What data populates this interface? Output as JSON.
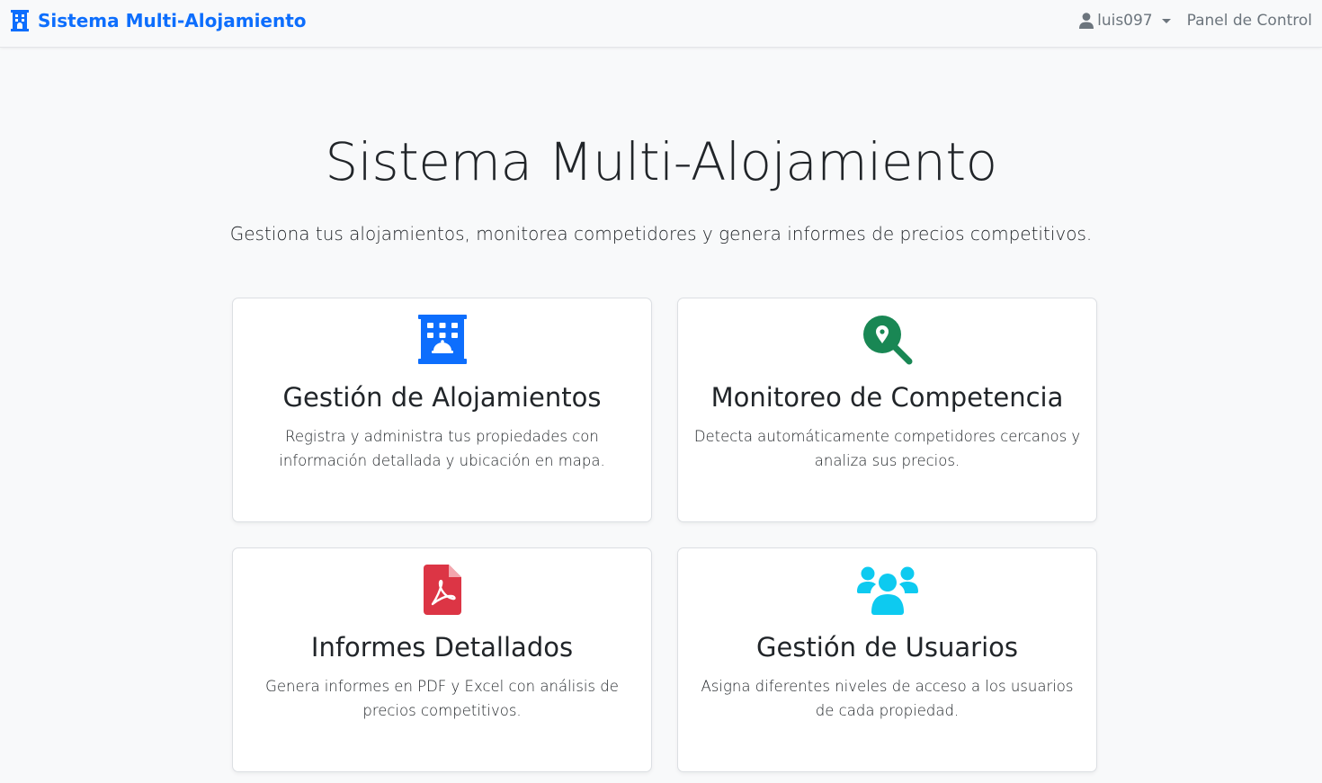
{
  "navbar": {
    "brand": "Sistema Multi-Alojamiento",
    "brand_icon": "building-icon",
    "username": "luis097",
    "user_icon": "user-icon",
    "panel_link": "Panel de Control"
  },
  "hero": {
    "title": "Sistema Multi-Alojamiento",
    "subtitle": "Gestiona tus alojamientos, monitorea competidores y genera informes de precios competitivos."
  },
  "features": [
    {
      "icon": "hotel-icon",
      "color": "#0d6efd",
      "title": "Gestión de Alojamientos",
      "text": "Registra y administra tus propiedades con información detallada y ubicación en mapa."
    },
    {
      "icon": "search-location-icon",
      "color": "#198754",
      "title": "Monitoreo de Competencia",
      "text": "Detecta automáticamente competidores cercanos y analiza sus precios."
    },
    {
      "icon": "file-pdf-icon",
      "color": "#dc3545",
      "title": "Informes Detallados",
      "text": "Genera informes en PDF y Excel con análisis de precios competitivos."
    },
    {
      "icon": "users-icon",
      "color": "#0dcaf0",
      "title": "Gestión de Usuarios",
      "text": "Asigna diferentes niveles de acceso a los usuarios de cada propiedad."
    }
  ]
}
